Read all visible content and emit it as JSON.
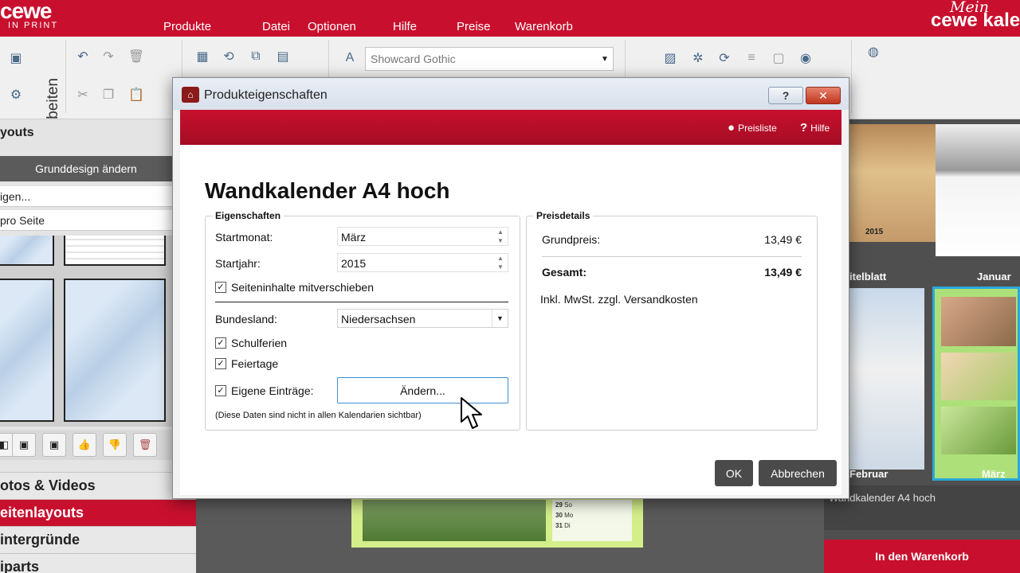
{
  "app": {
    "logo_text": "cewe",
    "logo_sub": "IN PRINT",
    "brand_right_script": "Mein",
    "brand_right_text": "cewe kale",
    "menu": [
      "Produkte",
      "Datei",
      "Optionen",
      "Hilfe",
      "Preise",
      "Warenkorb"
    ]
  },
  "toolbar": {
    "section_label": "Bearbeiten",
    "font_name": "Showcard Gothic"
  },
  "left_panel": {
    "title": "youts",
    "grund_button": "Grunddesign ändern",
    "row1": "igen...",
    "row2": "pro Seite",
    "categories": [
      {
        "label": "otos & Videos",
        "active": false
      },
      {
        "label": "eitenlayouts",
        "active": true
      },
      {
        "label": "intergründe",
        "active": false
      },
      {
        "label": "iparts",
        "active": false
      }
    ]
  },
  "right_panel": {
    "year_label": "2015",
    "labels": [
      "itelblatt",
      "Januar",
      "Februar",
      "März"
    ],
    "product_info": "Wandkalender A4 hoch",
    "cart_button": "In den Warenkorb"
  },
  "canvas": {
    "cal_rows": [
      {
        "day": "29",
        "wd": "So"
      },
      {
        "day": "30",
        "wd": "Mo"
      },
      {
        "day": "31",
        "wd": "Di"
      }
    ]
  },
  "dialog": {
    "title": "Produkteigenschaften",
    "help_glyph": "?",
    "close_glyph": "✕",
    "preisliste": "Preisliste",
    "hilfe": "Hilfe",
    "product_title": "Wandkalender A4 hoch",
    "eigenschaften": {
      "legend": "Eigenschaften",
      "startmonat_label": "Startmonat:",
      "startmonat_value": "März",
      "startjahr_label": "Startjahr:",
      "startjahr_value": "2015",
      "seiteninhalte": "Seiteninhalte mitverschieben",
      "bundesland_label": "Bundesland:",
      "bundesland_value": "Niedersachsen",
      "schulferien": "Schulferien",
      "feiertage": "Feiertage",
      "eigene": "Eigene Einträge:",
      "aendern_button": "Ändern...",
      "note": "(Diese Daten sind nicht in allen Kalendarien sichtbar)"
    },
    "preisdetails": {
      "legend": "Preisdetails",
      "grundpreis_label": "Grundpreis:",
      "grundpreis_value": "13,49 €",
      "gesamt_label": "Gesamt:",
      "gesamt_value": "13,49 €",
      "vat_note": "Inkl. MwSt. zzgl. Versandkosten"
    },
    "ok_button": "OK",
    "cancel_button": "Abbrechen"
  },
  "colors": {
    "brand_red": "#c8102e",
    "focus_blue": "#3c8fd3"
  }
}
